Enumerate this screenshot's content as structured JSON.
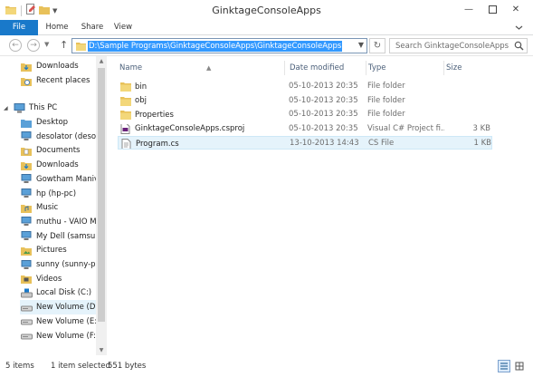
{
  "window": {
    "title": "GinktageConsoleApps"
  },
  "ribbon": {
    "tabs": [
      "File",
      "Home",
      "Share",
      "View"
    ]
  },
  "address": {
    "path": "D:\\Sample Programs\\GinktageConsoleApps\\GinktageConsoleApps",
    "search_placeholder": "Search GinktageConsoleApps"
  },
  "nav": {
    "quick_items": [
      {
        "label": "Downloads",
        "icon": "downloads-folder-icon"
      },
      {
        "label": "Recent places",
        "icon": "recent-places-icon"
      }
    ],
    "this_pc": "This PC",
    "items": [
      {
        "label": "Desktop",
        "icon": "desktop-folder-icon"
      },
      {
        "label": "desolator (desola",
        "icon": "network-pc-icon"
      },
      {
        "label": "Documents",
        "icon": "documents-folder-icon"
      },
      {
        "label": "Downloads",
        "icon": "downloads-folder-icon"
      },
      {
        "label": "Gowtham Manive",
        "icon": "network-pc-icon"
      },
      {
        "label": "hp (hp-pc)",
        "icon": "network-pc-icon"
      },
      {
        "label": "Music",
        "icon": "music-folder-icon"
      },
      {
        "label": "muthu - VAIO Me",
        "icon": "network-pc-icon"
      },
      {
        "label": "My Dell (samsung",
        "icon": "network-pc-icon"
      },
      {
        "label": "Pictures",
        "icon": "pictures-folder-icon"
      },
      {
        "label": "sunny (sunny-pc)",
        "icon": "network-pc-icon"
      },
      {
        "label": "Videos",
        "icon": "videos-folder-icon"
      },
      {
        "label": "Local Disk (C:)",
        "icon": "windows-drive-icon"
      },
      {
        "label": "New Volume (D:)",
        "icon": "drive-icon",
        "selected": true
      },
      {
        "label": "New Volume (E:)",
        "icon": "drive-icon"
      },
      {
        "label": "New Volume (F:)",
        "icon": "drive-icon"
      }
    ]
  },
  "columns": {
    "name": "Name",
    "date": "Date modified",
    "type": "Type",
    "size": "Size"
  },
  "files": [
    {
      "name": "bin",
      "date": "05-10-2013 20:35",
      "type": "File folder",
      "size": "",
      "icon": "folder-icon"
    },
    {
      "name": "obj",
      "date": "05-10-2013 20:35",
      "type": "File folder",
      "size": "",
      "icon": "folder-icon"
    },
    {
      "name": "Properties",
      "date": "05-10-2013 20:35",
      "type": "File folder",
      "size": "",
      "icon": "folder-icon"
    },
    {
      "name": "GinktageConsoleApps.csproj",
      "date": "05-10-2013 20:35",
      "type": "Visual C# Project fi...",
      "size": "3 KB",
      "icon": "csproj-file-icon"
    },
    {
      "name": "Program.cs",
      "date": "13-10-2013 14:43",
      "type": "CS File",
      "size": "1 KB",
      "icon": "cs-file-icon",
      "selected": true
    }
  ],
  "status": {
    "items": "5 items",
    "selected": "1 item selected",
    "size": "551 bytes"
  },
  "colors": {
    "accent": "#1979ca",
    "selection": "#e5f3fb",
    "path_highlight": "#3399ff",
    "folder": "#e8c15a"
  }
}
